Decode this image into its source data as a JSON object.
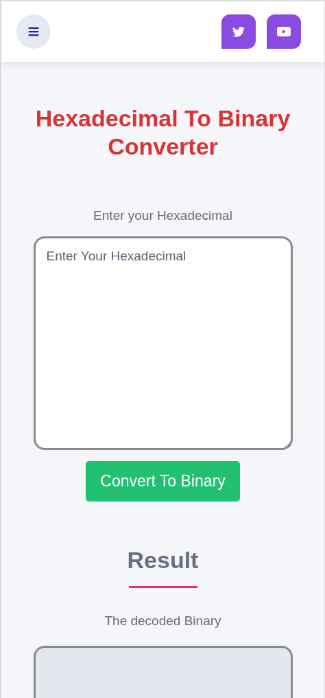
{
  "header": {
    "menu_button": {
      "label": "≡"
    },
    "social_buttons": [
      {
        "kind": "twitter"
      },
      {
        "kind": "youtube"
      }
    ]
  },
  "title": "Hexadecimal To Binary Converter",
  "input": {
    "label": "Enter your Hexadecimal",
    "placeholder": "Enter Your Hexadecimal"
  },
  "convert_button": "Convert To Binary",
  "result": {
    "heading": "Result",
    "label": "The decoded Binary",
    "output": {
      "disabled": true
    }
  }
}
